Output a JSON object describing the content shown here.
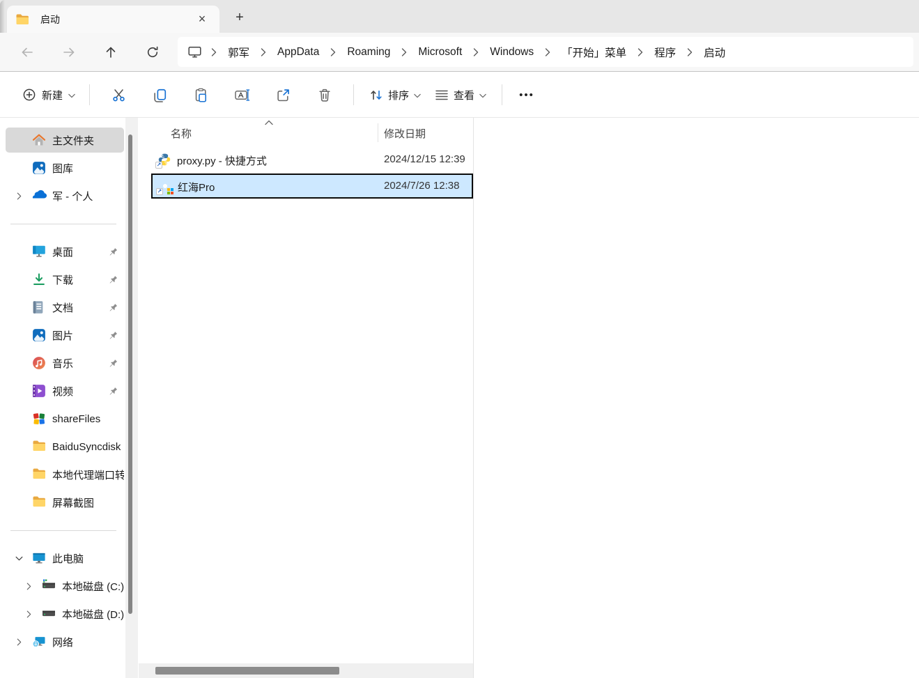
{
  "colors": {
    "accent": "#1a73d4",
    "selection_bg": "#cde8ff",
    "selection_border": "#0b0b0b",
    "sidebar_highlight": "#d9d9d9",
    "folder_yellow": "#ffd567",
    "tabbar_bg": "#e7e7e7"
  },
  "tab": {
    "label": "启动",
    "close_glyph": "×",
    "new_tab_glyph": "+"
  },
  "nav": {
    "breadcrumb": [
      "郭军",
      "AppData",
      "Roaming",
      "Microsoft",
      "Windows",
      "「开始」菜单",
      "程序",
      "启动"
    ]
  },
  "toolbar": {
    "new_label": "新建",
    "sort_label": "排序",
    "view_label": "查看",
    "more_glyph": "•••",
    "icons": [
      "new",
      "cut",
      "copy",
      "paste",
      "rename",
      "share",
      "delete",
      "sort",
      "view",
      "more"
    ]
  },
  "sidebar": {
    "items": [
      {
        "label": "主文件夹",
        "icon": "home-icon",
        "selected": true
      },
      {
        "label": "图库",
        "icon": "gallery-icon"
      },
      {
        "label": "军 - 个人",
        "icon": "onedrive-icon",
        "chevron": "right"
      },
      {
        "label": "桌面",
        "icon": "desktop-icon",
        "pinned": true
      },
      {
        "label": "下载",
        "icon": "downloads-icon",
        "pinned": true
      },
      {
        "label": "文档",
        "icon": "documents-icon",
        "pinned": true
      },
      {
        "label": "图片",
        "icon": "pictures-icon",
        "pinned": true
      },
      {
        "label": "音乐",
        "icon": "music-icon",
        "pinned": true
      },
      {
        "label": "视频",
        "icon": "videos-icon",
        "pinned": true
      },
      {
        "label": "shareFiles",
        "icon": "sharefiles-icon"
      },
      {
        "label": "BaiduSyncdisk",
        "icon": "folder-icon"
      },
      {
        "label": "本地代理端口转",
        "icon": "folder-icon"
      },
      {
        "label": "屏幕截图",
        "icon": "folder-icon"
      },
      {
        "label": "此电脑",
        "icon": "this-pc-icon",
        "chevron": "down"
      },
      {
        "label": "本地磁盘 (C:)",
        "icon": "drive-c-icon",
        "chevron": "right",
        "indent": true
      },
      {
        "label": "本地磁盘 (D:)",
        "icon": "drive-d-icon",
        "chevron": "right",
        "indent": true
      },
      {
        "label": "网络",
        "icon": "network-icon",
        "chevron": "right"
      }
    ]
  },
  "main": {
    "columns": {
      "name": "名称",
      "date": "修改日期"
    },
    "sort": {
      "column": "名称",
      "direction": "ascending"
    },
    "files": [
      {
        "name": "proxy.py - 快捷方式",
        "date": "2024/12/15 12:39",
        "icon": "python-shortcut-icon",
        "selected": false
      },
      {
        "name": "红海Pro",
        "date": "2024/7/26 12:38",
        "icon": "redsea-shortcut-icon",
        "selected": true
      }
    ]
  }
}
